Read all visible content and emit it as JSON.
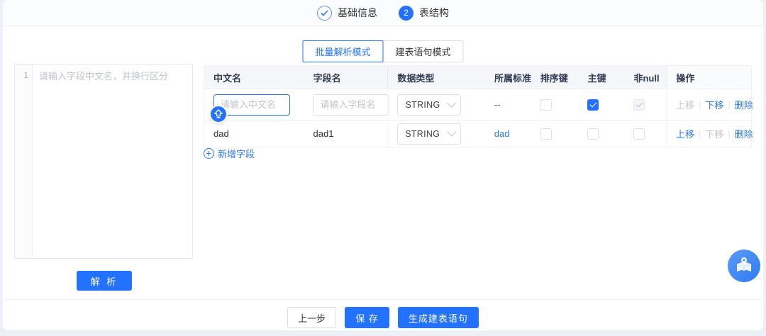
{
  "colors": {
    "primary": "#2272ff",
    "link": "#2b77f5",
    "page_bg": "#edf1f7",
    "header_bg": "#f4f6f9"
  },
  "stepper": {
    "step1": {
      "label": "基础信息",
      "state": "done",
      "icon": "check-circle-icon"
    },
    "step2": {
      "number": "2",
      "label": "表结构",
      "state": "active"
    }
  },
  "tabs": {
    "parse_mode": "批量解析模式",
    "sql_mode": "建表语句模式",
    "active": "批量解析模式"
  },
  "editor": {
    "line_number": "1",
    "placeholder": "请输入字段中文名，并换行区分",
    "parse_button": "解 析"
  },
  "table": {
    "headers": [
      "中文名",
      "字段名",
      "数据类型",
      "所属标准",
      "排序键",
      "主键",
      "非null",
      "操作"
    ],
    "rows": [
      {
        "cn_placeholder": "请输入中文名",
        "field_placeholder": "请输入字段名",
        "data_type": "STRING",
        "standard": "--",
        "sort_key": false,
        "primary_key": true,
        "not_null": true,
        "not_null_disabled": true,
        "actions": {
          "up": "上移",
          "down": "下移",
          "delete": "删除"
        },
        "up_disabled": true
      },
      {
        "cn": "dad",
        "field": "dad1",
        "data_type": "STRING",
        "standard": "dad",
        "sort_key": false,
        "primary_key": false,
        "not_null": false,
        "actions": {
          "up": "上移",
          "down": "下移",
          "delete": "删除"
        },
        "down_disabled": true
      }
    ],
    "add_field": "新增字段"
  },
  "footer": {
    "prev": "上一步",
    "save": "保 存",
    "generate": "生成建表语句"
  },
  "icons": {
    "ime_badge": "shift-input-icon",
    "floating": "map-guide-icon",
    "select_arrow": "chevron-down-icon",
    "add": "plus-circle-icon"
  }
}
